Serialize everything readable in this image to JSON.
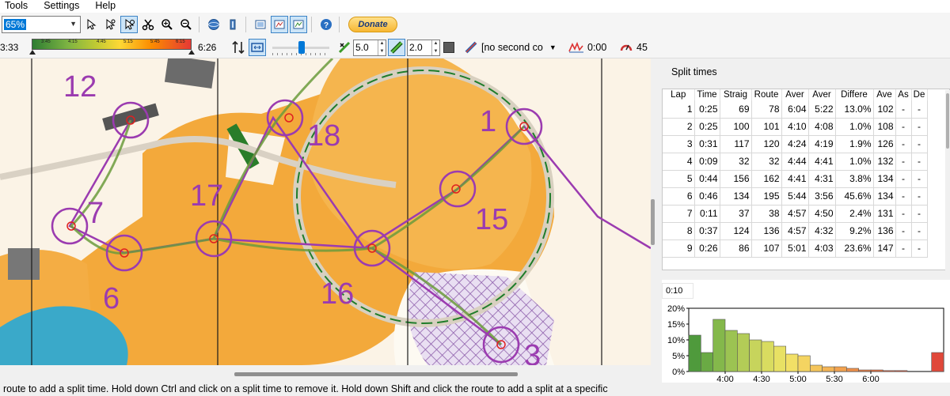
{
  "menu": [
    "Tools",
    "Settings",
    "Help"
  ],
  "toolbar": {
    "zoom_value": "65%",
    "donate_label": "Donate"
  },
  "toolbar2": {
    "time_left": "3:33",
    "colorbar_labels": [
      "3:45",
      "4:15",
      "4:45",
      "5:15",
      "5:45",
      "6:15"
    ],
    "time_right": "6:26",
    "line_width": "5.0",
    "mask_width": "2.0",
    "second_color": "[no second co",
    "pace_value": "0:00",
    "hr_value": "45"
  },
  "map": {
    "control_numbers": [
      "12",
      "18",
      "1",
      "17",
      "7",
      "15",
      "6",
      "16",
      "3"
    ]
  },
  "panel": {
    "title": "Split times",
    "columns": [
      "Lap",
      "Time",
      "Straig",
      "Route",
      "Aver",
      "Aver",
      "Differe",
      "Ave",
      "As",
      "De"
    ],
    "rows": [
      [
        "1",
        "0:25",
        "69",
        "78",
        "6:04",
        "5:22",
        "13.0%",
        "102",
        "-",
        "-"
      ],
      [
        "2",
        "0:25",
        "100",
        "101",
        "4:10",
        "4:08",
        "1.0%",
        "108",
        "-",
        "-"
      ],
      [
        "3",
        "0:31",
        "117",
        "120",
        "4:24",
        "4:19",
        "1.9%",
        "126",
        "-",
        "-"
      ],
      [
        "4",
        "0:09",
        "32",
        "32",
        "4:44",
        "4:41",
        "1.0%",
        "132",
        "-",
        "-"
      ],
      [
        "5",
        "0:44",
        "156",
        "162",
        "4:41",
        "4:31",
        "3.8%",
        "134",
        "-",
        "-"
      ],
      [
        "6",
        "0:46",
        "134",
        "195",
        "5:44",
        "3:56",
        "45.6%",
        "134",
        "-",
        "-"
      ],
      [
        "7",
        "0:11",
        "37",
        "38",
        "4:57",
        "4:50",
        "2.4%",
        "131",
        "-",
        "-"
      ],
      [
        "8",
        "0:37",
        "124",
        "136",
        "4:57",
        "4:32",
        "9.2%",
        "136",
        "-",
        "-"
      ],
      [
        "9",
        "0:26",
        "86",
        "107",
        "5:01",
        "4:03",
        "23.6%",
        "147",
        "-",
        "-"
      ]
    ]
  },
  "histogram": {
    "time_label": "0:10"
  },
  "chart_data": {
    "type": "bar",
    "x_ticks": [
      "4:00",
      "4:30",
      "5:00",
      "5:30",
      "6:00"
    ],
    "y_ticks": [
      "0%",
      "5%",
      "10%",
      "15%",
      "20%"
    ],
    "ylim": [
      0,
      20
    ],
    "bins_start_sec": 210,
    "bin_width_sec": 10,
    "values": [
      11.5,
      6,
      16.5,
      13,
      12,
      10,
      9.5,
      8,
      5.5,
      5,
      2,
      1.5,
      1.5,
      1,
      0.5,
      0.5,
      0.3,
      0.3,
      0,
      0,
      6
    ],
    "colors": [
      "#4f9a3c",
      "#6aaa44",
      "#84b84b",
      "#9cc352",
      "#b3cc57",
      "#c7d45c",
      "#d9dc60",
      "#e8e164",
      "#f2e066",
      "#f4d461",
      "#f5c55b",
      "#f4b455",
      "#f2a24f",
      "#ef904a",
      "#ec7f45",
      "#e87040",
      "#e5613c",
      "#e25538",
      "#df4a35",
      "#dc4133",
      "#e0483a"
    ]
  },
  "status_text": "route to add a split time. Hold down Ctrl and click on a split time to remove it. Hold down Shift and click the route to add a split at a specific"
}
